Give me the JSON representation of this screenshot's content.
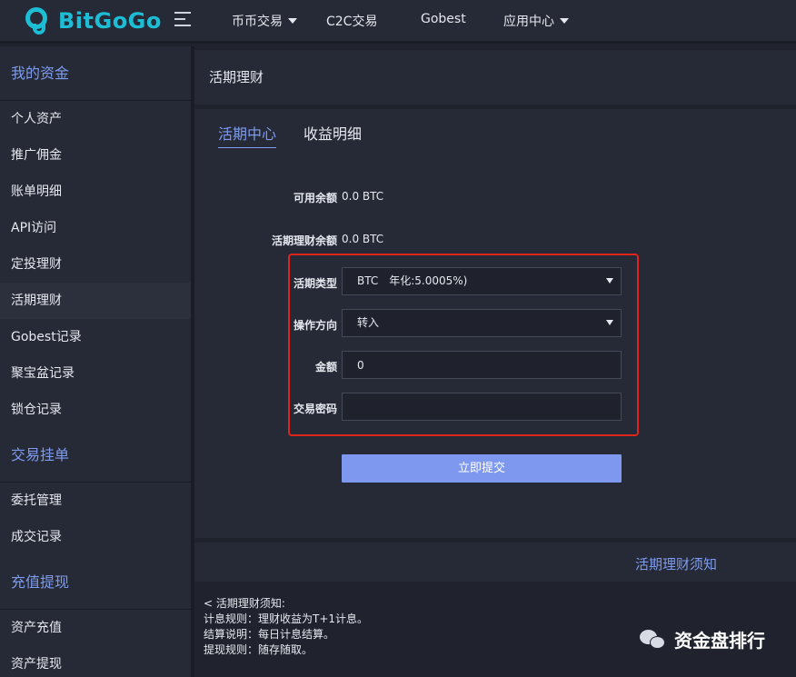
{
  "brand": {
    "name": "BitGoGo",
    "color": "#1ebdd6"
  },
  "nav": {
    "menu_icon": "menu-icon",
    "items": [
      {
        "label": "币币交易",
        "dropdown": true
      },
      {
        "label": "C2C交易",
        "dropdown": false
      },
      {
        "label": "Gobest",
        "dropdown": false
      },
      {
        "label": "应用中心",
        "dropdown": true
      }
    ]
  },
  "sidebar": {
    "groups": [
      {
        "title": "我的资金",
        "items": [
          "个人资产",
          "推广佣金",
          "账单明细",
          "API访问",
          "定投理财",
          "活期理财",
          "Gobest记录",
          "聚宝盆记录",
          "锁仓记录"
        ]
      },
      {
        "title": "交易挂单",
        "items": [
          "委托管理",
          "成交记录"
        ]
      },
      {
        "title": "充值提现",
        "items": [
          "资产充值",
          "资产提现"
        ]
      }
    ],
    "active_item": "活期理财"
  },
  "page": {
    "title": "活期理财",
    "tabs": [
      {
        "label": "活期中心",
        "active": true
      },
      {
        "label": "收益明细",
        "active": false
      }
    ]
  },
  "info": {
    "available_label": "可用余额",
    "available_value": "0.0 BTC",
    "current_label": "活期理财余额",
    "current_value": "0.0 BTC"
  },
  "form": {
    "type_label": "活期类型",
    "type_value": "BTC　年化:5.0005%)",
    "direction_label": "操作方向",
    "direction_value": "转入",
    "amount_label": "金额",
    "amount_value": "0",
    "password_label": "交易密码",
    "password_value": "",
    "submit_label": "立即提交"
  },
  "notice": {
    "title": "活期理财须知",
    "lines": [
      "< 活期理财须知:",
      "计息规则：理财收益为T+1计息。",
      "结算说明：每日计息结算。",
      "提现规则：随存随取。"
    ]
  },
  "watermark": {
    "text": "资金盘排行",
    "icon": "wechat-icon"
  },
  "colors": {
    "accent": "#7e9bf0",
    "highlight_border": "#e0241b",
    "panel": "#252a36",
    "background": "#20232e"
  }
}
